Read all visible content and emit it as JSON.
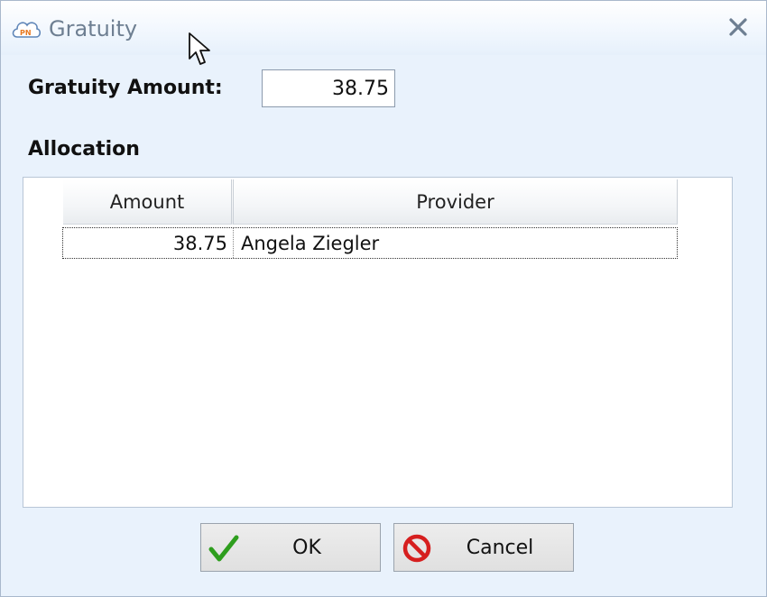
{
  "window": {
    "title": "Gratuity",
    "app_icon": "pn-cloud-logo-icon",
    "close_icon": "close-icon"
  },
  "form": {
    "gratuity_label": "Gratuity Amount:",
    "gratuity_value": "38.75"
  },
  "allocation": {
    "label": "Allocation",
    "columns": [
      "Amount",
      "Provider"
    ],
    "rows": [
      {
        "amount": "38.75",
        "provider": "Angela Ziegler"
      }
    ]
  },
  "buttons": {
    "ok_label": "OK",
    "ok_icon": "checkmark-icon",
    "cancel_label": "Cancel",
    "cancel_icon": "no-entry-icon"
  },
  "colors": {
    "window_bg": "#e9f2fc",
    "title_text": "#6e7f92",
    "ok_check": "#2e9e1e",
    "cancel_red": "#d61f1f"
  }
}
